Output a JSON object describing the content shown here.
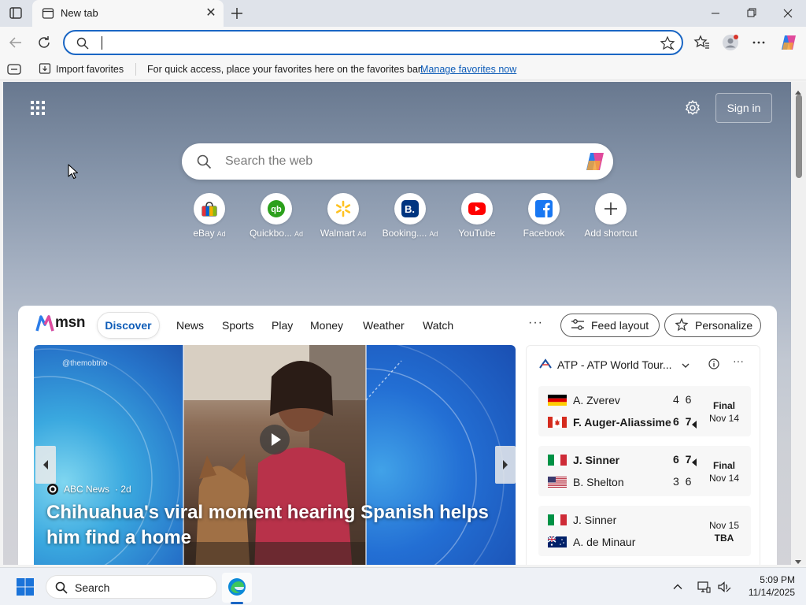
{
  "browser": {
    "tab_title": "New tab",
    "tab_close_glyph": "✕",
    "new_tab_icon": "plus-icon",
    "address_value": "",
    "window_controls": [
      "minimize-icon",
      "restore-icon",
      "close-icon"
    ]
  },
  "favorites_bar": {
    "import_label": "Import favorites",
    "hint": "For quick access, place your favorites here on the favorites bar.",
    "manage_link": "Manage favorites now"
  },
  "newtab": {
    "sign_in_label": "Sign in",
    "search_placeholder": "Search the web",
    "shortcuts": [
      {
        "label": "eBay",
        "ad": "Ad",
        "icon": "ebay-icon",
        "color": "#e53238"
      },
      {
        "label": "Quickbo...",
        "ad": "Ad",
        "icon": "quickbooks-icon",
        "color": "#2ca01c"
      },
      {
        "label": "Walmart",
        "ad": "Ad",
        "icon": "walmart-icon",
        "color": "#0071ce"
      },
      {
        "label": "Booking....",
        "ad": "Ad",
        "icon": "booking-icon",
        "color": "#003580"
      },
      {
        "label": "YouTube",
        "ad": "",
        "icon": "youtube-icon",
        "color": "#ff0000"
      },
      {
        "label": "Facebook",
        "ad": "",
        "icon": "facebook-icon",
        "color": "#1877f2"
      },
      {
        "label": "Add shortcut",
        "ad": "",
        "icon": "plus-icon",
        "color": "#333333"
      }
    ]
  },
  "feed": {
    "brand": "msn",
    "tabs": [
      "Discover",
      "News",
      "Sports",
      "Play",
      "Money",
      "Weather",
      "Watch"
    ],
    "more_glyph": "···",
    "feed_layout_label": "Feed layout",
    "personalize_label": "Personalize",
    "hero": {
      "watermark": "@themobtrio",
      "source": "ABC News",
      "age": "· 2d",
      "headline": "Chihuahua's viral moment hearing Spanish helps him find a home"
    },
    "sports": {
      "title": "ATP - ATP World Tour...",
      "more_glyph": "···",
      "matches": [
        {
          "players": [
            {
              "name": "A. Zverev",
              "flag": "germany",
              "score": "4 6",
              "winner": false,
              "serve": false
            },
            {
              "name": "F. Auger-Aliassime",
              "flag": "canada",
              "score": "6 7",
              "winner": true,
              "serve": true
            }
          ],
          "status": "Final",
          "date": "Nov 14"
        },
        {
          "players": [
            {
              "name": "J. Sinner",
              "flag": "italy",
              "score": "6 7",
              "winner": true,
              "serve": true
            },
            {
              "name": "B. Shelton",
              "flag": "usa",
              "score": "3 6",
              "winner": false,
              "serve": false
            }
          ],
          "status": "Final",
          "date": "Nov 14"
        },
        {
          "players": [
            {
              "name": "J. Sinner",
              "flag": "italy",
              "score": "",
              "winner": false,
              "serve": false
            },
            {
              "name": "A. de Minaur",
              "flag": "australia",
              "score": "",
              "winner": false,
              "serve": false
            }
          ],
          "status": "Nov 15",
          "date": "TBA"
        }
      ]
    }
  },
  "taskbar": {
    "search_label": "Search",
    "time": "5:09 PM",
    "date": "11/14/2025"
  },
  "colors": {
    "accent": "#1a66c4",
    "link": "#0f5db8"
  }
}
